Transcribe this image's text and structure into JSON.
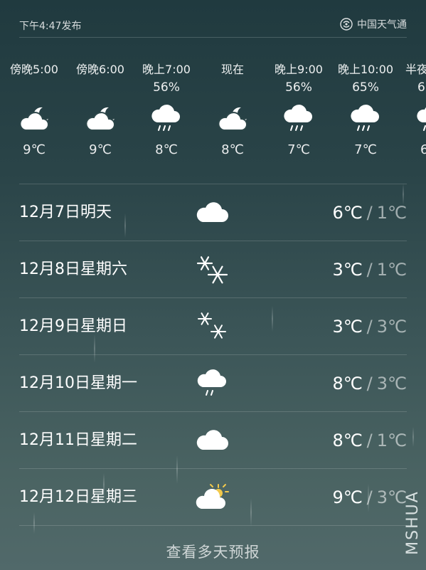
{
  "header": {
    "publish_time": "下午4:47发布",
    "provider": "中国天气通",
    "provider_icon": "weather-provider-logo-icon"
  },
  "hourly": [
    {
      "time": "傍晚5:00",
      "pop": "",
      "icon": "cloudy-night-icon",
      "temp": "9℃"
    },
    {
      "time": "傍晚6:00",
      "pop": "",
      "icon": "cloudy-night-icon",
      "temp": "9℃"
    },
    {
      "time": "晚上7:00",
      "pop": "56%",
      "icon": "light-rain-icon",
      "temp": "8℃"
    },
    {
      "time": "现在",
      "pop": "",
      "icon": "cloudy-night-icon",
      "temp": "8℃"
    },
    {
      "time": "晚上9:00",
      "pop": "56%",
      "icon": "light-rain-icon",
      "temp": "7℃"
    },
    {
      "time": "晚上10:00",
      "pop": "65%",
      "icon": "light-rain-icon",
      "temp": "7℃"
    },
    {
      "time": "半夜",
      "pop": "6",
      "icon": "light-rain-icon",
      "temp": "6"
    }
  ],
  "daily": [
    {
      "date": "12月7日明天",
      "icon": "cloud-icon",
      "high": "6℃",
      "sep": "/",
      "low": "1℃"
    },
    {
      "date": "12月8日星期六",
      "icon": "snow-icon",
      "high": "3℃",
      "sep": "/",
      "low": "1℃"
    },
    {
      "date": "12月9日星期日",
      "icon": "snow-icon",
      "high": "3℃",
      "sep": "/",
      "low": "3℃"
    },
    {
      "date": "12月10日星期一",
      "icon": "light-rain-icon",
      "high": "8℃",
      "sep": "/",
      "low": "3℃"
    },
    {
      "date": "12月11日星期二",
      "icon": "cloud-icon",
      "high": "8℃",
      "sep": "/",
      "low": "1℃"
    },
    {
      "date": "12月12日星期三",
      "icon": "partly-sunny-icon",
      "high": "9℃",
      "sep": "/",
      "low": "3℃"
    }
  ],
  "more_link": "查看多天预报",
  "watermark": "MSHUA",
  "colors": {
    "background_top": "#203a3f",
    "background_bottom": "#51696a",
    "text": "#ffffff",
    "sun": "#f2c94c"
  }
}
